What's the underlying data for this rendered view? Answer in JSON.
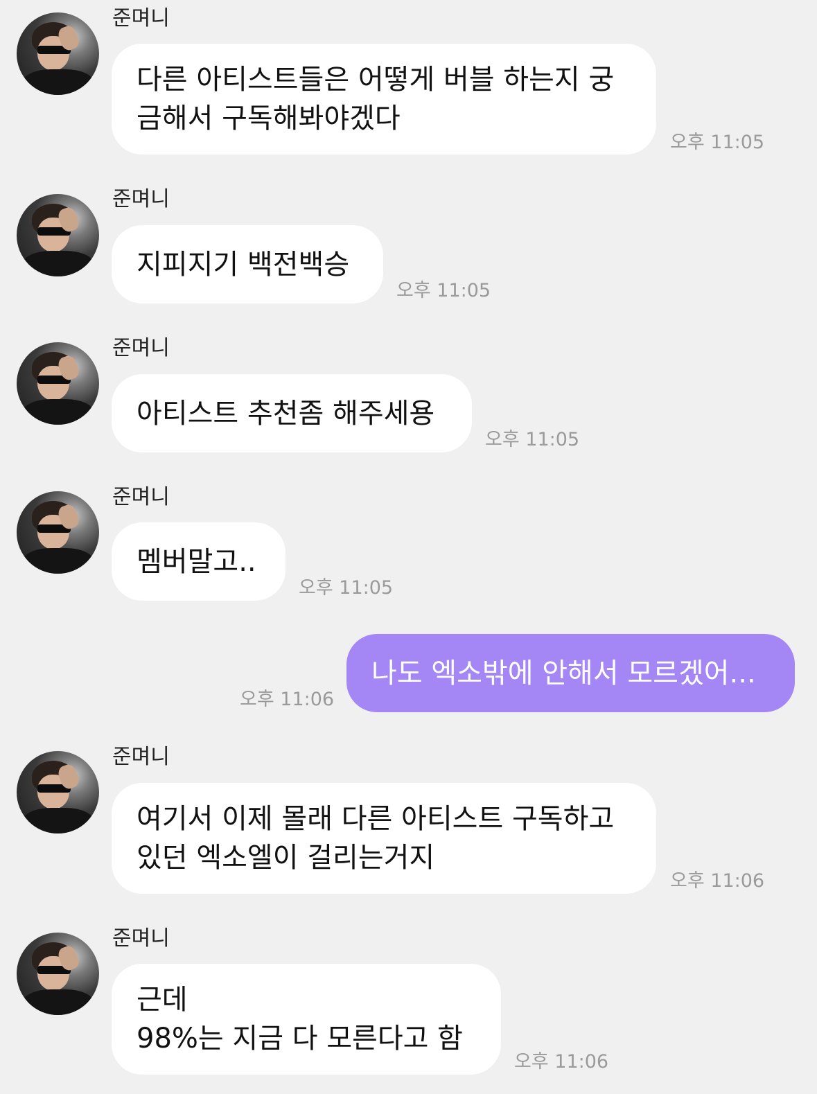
{
  "sender_name": "준며니",
  "messages": [
    {
      "from": "other",
      "text": "다른 아티스트들은 어떻게 버블 하는지 궁\n금해서 구독해봐야겠다",
      "time": "오후 11:05"
    },
    {
      "from": "other",
      "text": "지피지기 백전백승",
      "time": "오후 11:05"
    },
    {
      "from": "other",
      "text": "아티스트 추천좀 해주세용",
      "time": "오후 11:05"
    },
    {
      "from": "other",
      "text": "멤버말고..",
      "time": "오후 11:05"
    },
    {
      "from": "me",
      "text": "나도 엑소밖에 안해서 모르겠어...",
      "time": "오후 11:06"
    },
    {
      "from": "other",
      "text": "여기서 이제 몰래 다른 아티스트 구독하고\n있던 엑소엘이 걸리는거지",
      "time": "오후 11:06"
    },
    {
      "from": "other",
      "text": "근데\n98%는 지금 다 모른다고 함",
      "time": "오후 11:06"
    }
  ]
}
